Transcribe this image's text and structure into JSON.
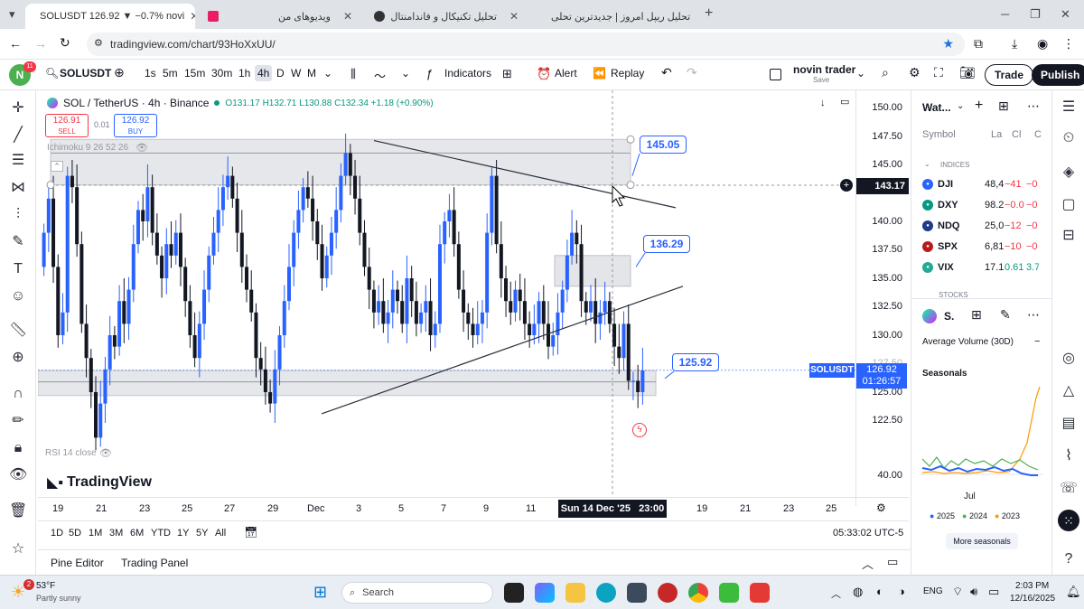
{
  "browser": {
    "tabs": [
      {
        "label": "SOLUSDT 126.92 ▼ −0.7% novi"
      },
      {
        "label": "ویدیوهای من"
      },
      {
        "label": "تحلیل تکنیکال و فاندامنتال"
      },
      {
        "label": "تحلیل ریپل امروز | جدیدترین تحلی"
      }
    ],
    "url": "tradingview.com/chart/93HoXxUU/"
  },
  "toolbar": {
    "avatar_letter": "N",
    "avatar_badge": "11",
    "symbol": "SOLUSDT",
    "intervals": [
      "1s",
      "5m",
      "15m",
      "30m",
      "1h",
      "4h",
      "D",
      "W",
      "M"
    ],
    "active_interval": "4h",
    "indicators": "Indicators",
    "alert": "Alert",
    "replay": "Replay",
    "layout_name": "novin trader",
    "layout_sub": "Save",
    "trade": "Trade",
    "publish": "Publish"
  },
  "chart": {
    "legend_title": "SOL / TetherUS · 4h · Binance",
    "ohlc": "O131.17 H132.71 L130.88 C132.34 +1.18 (+0.90%)",
    "sell_price": "126.91",
    "sell_label": "SELL",
    "spread": "0.01",
    "buy_price": "126.92",
    "buy_label": "BUY",
    "indicator1": "Ichimoku 9 26 52 26",
    "indicator2": "RSI 14 close",
    "logo": "TradingView",
    "price_labels": [
      "150.00",
      "147.50",
      "145.00",
      "140.00",
      "137.50",
      "135.00",
      "132.50",
      "130.00",
      "127.50",
      "125.00",
      "122.50",
      "40.00"
    ],
    "crosshair_price": "143.17",
    "current_symbol": "SOLUSDT",
    "current_price": "126.92",
    "countdown": "01:26:57",
    "callouts": [
      "145.05",
      "136.29",
      "125.92"
    ],
    "time_labels": [
      "19",
      "21",
      "23",
      "25",
      "27",
      "29",
      "Dec",
      "3",
      "5",
      "7",
      "9",
      "11",
      "19",
      "21",
      "23",
      "25"
    ],
    "crosshair_time": "Sun 14 Dec '25   23:00",
    "ranges": [
      "1D",
      "5D",
      "1M",
      "3M",
      "6M",
      "YTD",
      "1Y",
      "5Y",
      "All"
    ],
    "clock": "05:33:02 UTC-5"
  },
  "bottom": {
    "pine": "Pine Editor",
    "trading_panel": "Trading Panel"
  },
  "watchlist": {
    "title": "Wat...",
    "col_symbol": "Symbol",
    "col_last": "La",
    "col_chg": "Cl",
    "col_chgp": "C",
    "section": "INDICES",
    "rows": [
      {
        "sym": "DJI",
        "last": "48,4",
        "chg": "−41",
        "chgp": "−0",
        "color": "#2962ff"
      },
      {
        "sym": "DXY",
        "last": "98.2",
        "chg": "−0.0",
        "chgp": "−0",
        "color": "#089981"
      },
      {
        "sym": "NDQ",
        "last": "25,0",
        "chg": "−12",
        "chgp": "−0",
        "color": "#1e3a8a"
      },
      {
        "sym": "SPX",
        "last": "6,81",
        "chg": "−10",
        "chgp": "−0",
        "color": "#b71c1c"
      },
      {
        "sym": "VIX",
        "last": "17.1",
        "chg": "0.61",
        "chgp": "3.7",
        "color": "#22ab94"
      }
    ],
    "stocks_section": "STOCKS",
    "detail_symbol": "S.",
    "avg_volume": "Average Volume (30D)",
    "seasonals": "Seasonals",
    "seasonal_month": "Jul",
    "legend": [
      {
        "year": "2025",
        "color": "#2962ff"
      },
      {
        "year": "2024",
        "color": "#4caf50"
      },
      {
        "year": "2023",
        "color": "#ff9800"
      }
    ],
    "more": "More seasonals"
  },
  "taskbar": {
    "temp": "53°F",
    "weather": "Partly sunny",
    "weather_badge": "2",
    "search": "Search",
    "lang": "ENG",
    "time": "2:03 PM",
    "date": "12/16/2025"
  },
  "colors": {
    "up": "#2962ff",
    "down": "#131722",
    "accent": "#2962ff"
  }
}
